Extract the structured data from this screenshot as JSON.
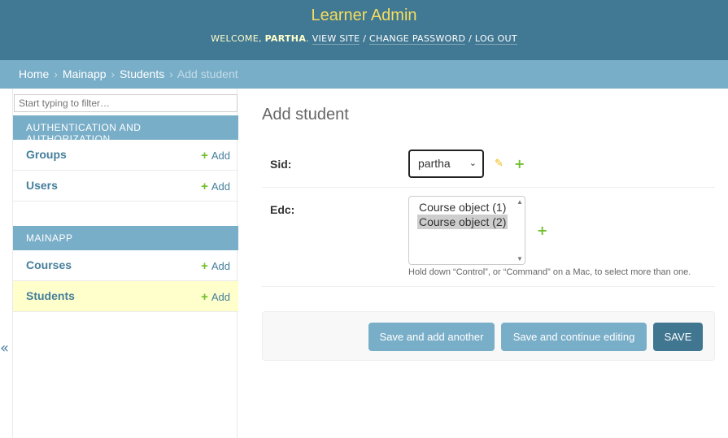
{
  "header": {
    "brand": "Learner Admin",
    "welcome": "Welcome, ",
    "username": "partha",
    "period": ".",
    "links": [
      "View site",
      "Change password",
      "Log out"
    ],
    "sep": " / "
  },
  "breadcrumbs": {
    "items": [
      "Home",
      "Mainapp",
      "Students"
    ],
    "current": "Add student",
    "arrow": "›"
  },
  "sidebar": {
    "toggle": "«",
    "filter_placeholder": "Start typing to filter…",
    "modules": [
      {
        "caption": "Authentication and Authorization",
        "rows": [
          {
            "name": "Groups",
            "add": "Add"
          },
          {
            "name": "Users",
            "add": "Add"
          }
        ]
      },
      {
        "caption": "Mainapp",
        "rows": [
          {
            "name": "Courses",
            "add": "Add"
          },
          {
            "name": "Students",
            "add": "Add"
          }
        ]
      }
    ]
  },
  "main": {
    "title": "Add student",
    "fields": {
      "sid": {
        "label": "Sid:",
        "value": "partha"
      },
      "edc": {
        "label": "Edc:",
        "options": [
          "Course object (1)",
          "Course object (2)"
        ],
        "selected_index": 1,
        "help": "Hold down “Control”, or “Command” on a Mac, to select more than one."
      }
    },
    "buttons": {
      "save_add": "Save and add another",
      "save_continue": "Save and continue editing",
      "save": "SAVE"
    }
  },
  "icons": {
    "plus": "+",
    "pencil": "✎",
    "chevron_down": "⌄",
    "scroll_up": "▲",
    "scroll_down": "▼"
  },
  "colors": {
    "header_bg": "#417893",
    "brand": "#f5dd5d",
    "breadcrumb_bg": "#79aec8",
    "link": "#447e9b",
    "add_green": "#70bf2b",
    "current_row": "#ffffcc",
    "save_btn": "#417690"
  }
}
